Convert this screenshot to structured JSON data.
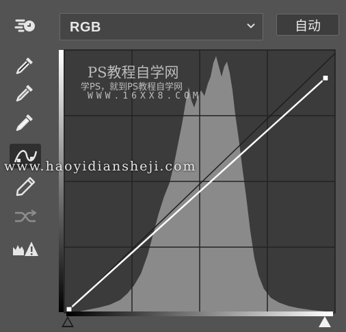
{
  "toolbar": {
    "tools": [
      {
        "name": "on-image-adjust-icon",
        "selected": false
      },
      {
        "name": "black-point-eyedropper-icon",
        "selected": false
      },
      {
        "name": "gray-point-eyedropper-icon",
        "selected": false
      },
      {
        "name": "white-point-eyedropper-icon",
        "selected": false
      },
      {
        "name": "curve-point-tool-icon",
        "selected": true
      },
      {
        "name": "pencil-tool-icon",
        "selected": false
      },
      {
        "name": "smooth-curve-icon",
        "selected": false
      },
      {
        "name": "clipping-warning-icon",
        "selected": false
      }
    ]
  },
  "channel_select": {
    "value": "RGB",
    "icon": "chevron-down-icon"
  },
  "auto_button": {
    "label": "自动"
  },
  "curve": {
    "input_black": 0,
    "output_black": 0,
    "input_white": 255,
    "output_white": 255,
    "histogram_color": "#8a8a8a",
    "graph_bg": "#3b3b3b",
    "curve_color": "#ffffff"
  },
  "watermark": {
    "title": "PS教程自学网",
    "subtitle": "学PS，就到PS教程自学网",
    "url": "WWW.16XX8.COM",
    "site": "www.haoyidiansheji.com"
  }
}
